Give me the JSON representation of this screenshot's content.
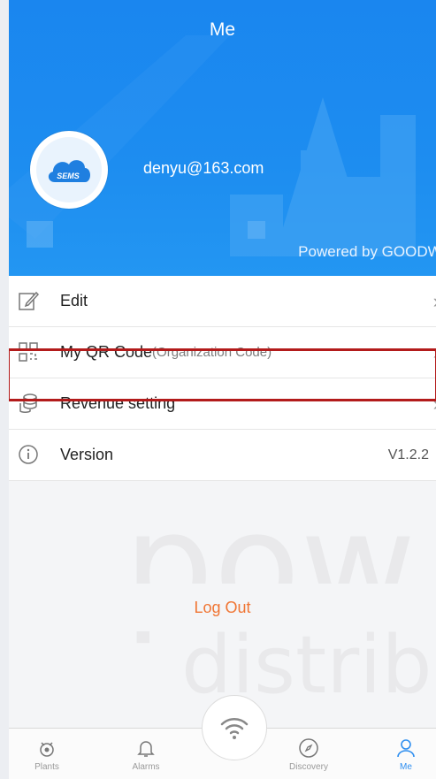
{
  "header": {
    "title": "Me",
    "email": "denyu@163.com",
    "powered_by": "Powered by GOODWE",
    "avatar_text": "SEMS"
  },
  "menu": {
    "edit": {
      "label": "Edit"
    },
    "qr": {
      "label": "My QR Code",
      "sub": "(Organization Code)"
    },
    "revenue": {
      "label": "Revenue setting"
    },
    "version": {
      "label": "Version",
      "value": "V1.2.2"
    }
  },
  "logout": {
    "label": "Log Out"
  },
  "tabs": [
    {
      "label": "Plants",
      "icon": "plant-icon"
    },
    {
      "label": "Alarms",
      "icon": "bell-icon"
    },
    {
      "label": "",
      "icon": "wifi-icon"
    },
    {
      "label": "Discovery",
      "icon": "compass-icon"
    },
    {
      "label": "Me",
      "icon": "user-icon"
    }
  ],
  "colors": {
    "accent": "#1d8df0",
    "logout": "#f07533",
    "highlight": "#b31b1b"
  }
}
